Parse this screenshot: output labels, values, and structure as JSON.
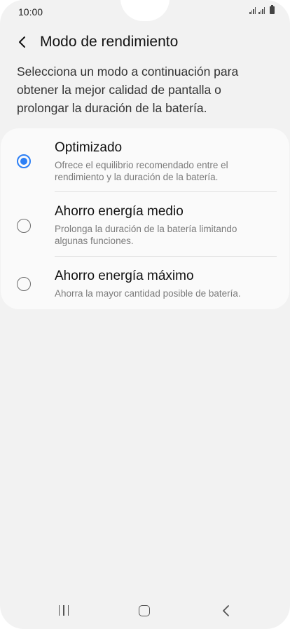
{
  "status_bar": {
    "time": "10:00",
    "icons": [
      "signal-icon",
      "signal-icon",
      "battery-icon"
    ]
  },
  "header": {
    "back_icon": "chevron-left-icon",
    "title": "Modo de rendimiento"
  },
  "description": "Selecciona un modo a continuación para obtener la mejor calidad de pantalla o prolongar la duración de la batería.",
  "options": [
    {
      "title": "Optimizado",
      "subtitle": "Ofrece el equilibrio recomendado entre el rendimiento y la duración de la batería.",
      "selected": true
    },
    {
      "title": "Ahorro energía medio",
      "subtitle": "Prolonga la duración de la batería limitando algunas funciones.",
      "selected": false
    },
    {
      "title": "Ahorro energía máximo",
      "subtitle": "Ahorra la mayor cantidad posible de batería.",
      "selected": false
    }
  ],
  "nav_bar": {
    "icons": [
      "recents-icon",
      "home-icon",
      "back-icon"
    ]
  },
  "colors": {
    "accent": "#2c7ff5",
    "background": "#f2f2f2",
    "card": "#fafafa"
  }
}
